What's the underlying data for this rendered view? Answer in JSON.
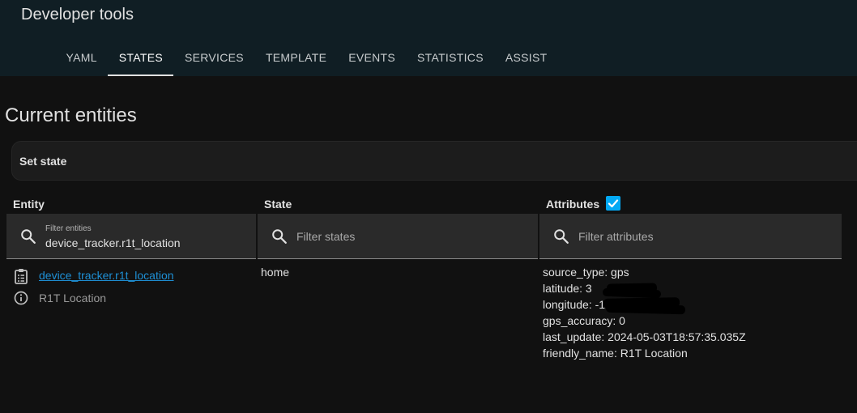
{
  "header": {
    "title": "Developer tools"
  },
  "tabs": [
    {
      "label": "YAML",
      "active": false
    },
    {
      "label": "STATES",
      "active": true
    },
    {
      "label": "SERVICES",
      "active": false
    },
    {
      "label": "TEMPLATE",
      "active": false
    },
    {
      "label": "EVENTS",
      "active": false
    },
    {
      "label": "STATISTICS",
      "active": false
    },
    {
      "label": "ASSIST",
      "active": false
    }
  ],
  "main": {
    "heading": "Current entities",
    "set_state_label": "Set state"
  },
  "table": {
    "columns": {
      "entity": "Entity",
      "state": "State",
      "attributes": "Attributes",
      "attributes_checked": true
    },
    "filters": {
      "entity_label": "Filter entities",
      "entity_value": "device_tracker.r1t_location",
      "state_placeholder": "Filter states",
      "attributes_placeholder": "Filter attributes"
    },
    "row": {
      "entity_id": "device_tracker.r1t_location",
      "friendly_name": "R1T Location",
      "state": "home",
      "attributes": [
        "source_type: gps",
        "latitude: 3",
        "longitude: -1",
        "gps_accuracy: 0",
        "last_update: 2024-05-03T18:57:35.035Z",
        "friendly_name: R1T Location"
      ]
    }
  },
  "colors": {
    "header_bg": "#101e24",
    "page_bg": "#111111",
    "link": "#1e90d6",
    "checkbox": "#03a9f4"
  },
  "icons": {
    "filter": "magnify-icon",
    "row_action": "clipboard-list-icon",
    "row_info": "info-circle-icon",
    "checkbox": "checkbox-checked-icon"
  }
}
